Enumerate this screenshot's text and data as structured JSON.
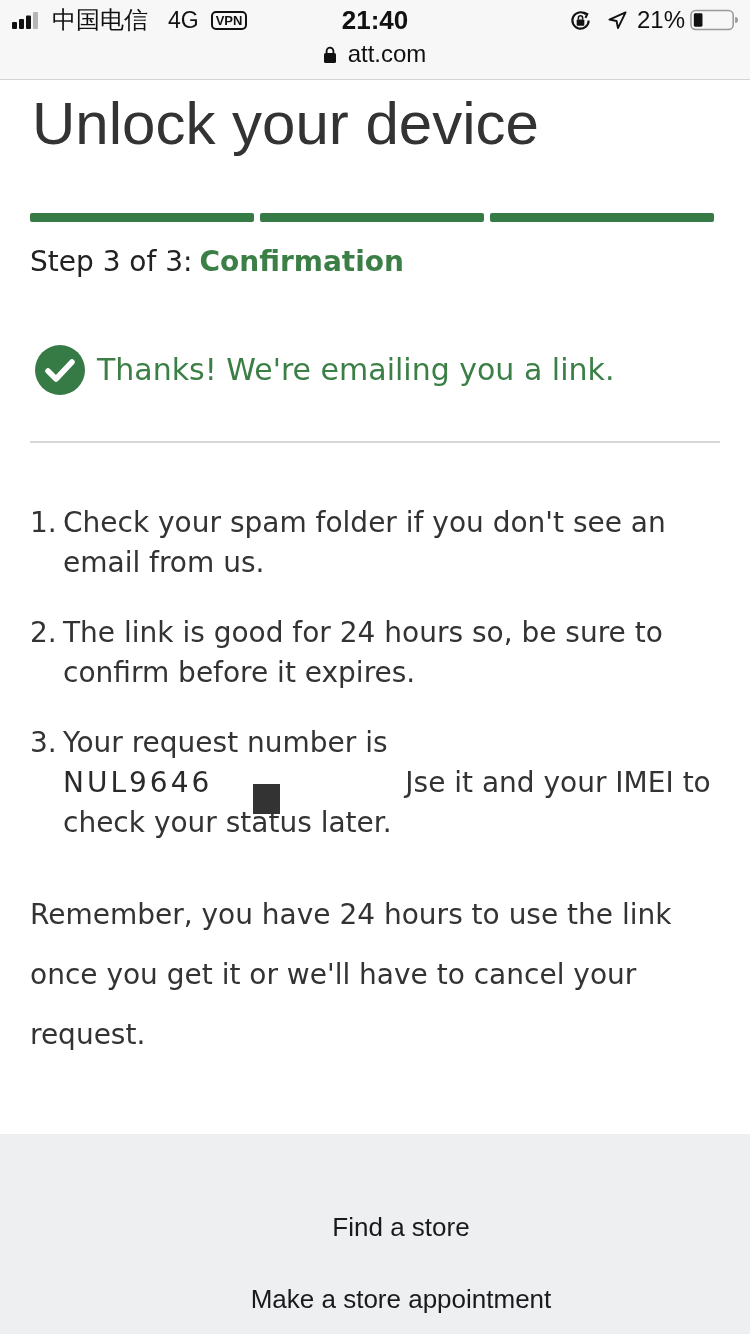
{
  "status_bar": {
    "carrier": "中国电信",
    "network": "4G",
    "vpn": "VPN",
    "time": "21:40",
    "battery": "21%"
  },
  "address_bar": {
    "url": "att.com"
  },
  "title": "Unlock your device",
  "progress": {
    "steps": [
      {
        "complete": true
      },
      {
        "complete": true
      },
      {
        "complete": true
      }
    ],
    "step_label": "Step 3 of 3:",
    "step_name": "Confirmation"
  },
  "success_message": "Thanks! We're emailing you a link.",
  "instructions": [
    {
      "kind": "text",
      "number": "1.",
      "text": "Check your spam folder if you don't see an email from us."
    },
    {
      "kind": "text",
      "number": "2.",
      "text": "The link is good for 24 hours so, be sure to confirm before it expires."
    },
    {
      "kind": "request",
      "number": "3.",
      "text": "Your request number is",
      "request_number": "NUL9646",
      "redacted": true,
      "text_after": "Jse it and your IMEI to check your status later."
    }
  ],
  "reminder": "Remember, you have 24 hours to use the link once you get it or we'll have to cancel your request.",
  "footer_links": [
    "Find a store",
    "Make a store appointment"
  ]
}
